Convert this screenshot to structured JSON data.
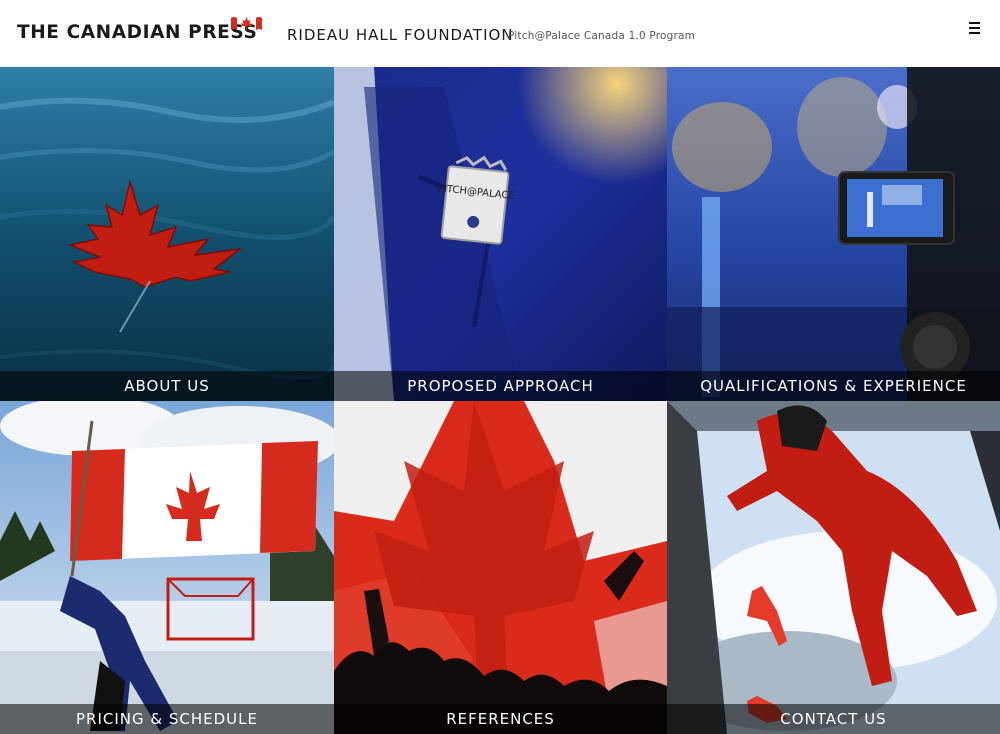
{
  "header": {
    "brand": "THE CANADIAN PRESS",
    "client": "RIDEAU HALL FOUNDATION",
    "program": "Pitch@Palace Canada 1.0 Program",
    "menu_icon": "hamburger-menu-icon"
  },
  "tiles": [
    {
      "label": "ABOUT US",
      "image": "maple-leaf-on-water"
    },
    {
      "label": "PROPOSED APPROACH",
      "image": "pitch-at-palace-lapel-pin",
      "pin_text": "PITCH@PALACE"
    },
    {
      "label": "QUALIFICATIONS & EXPERIENCE",
      "image": "video-camera-at-event"
    },
    {
      "label": "PRICING & SCHEDULE",
      "image": "hockey-player-with-canadian-flag"
    },
    {
      "label": "REFERENCES",
      "image": "crowd-under-giant-canadian-flag"
    },
    {
      "label": "CONTACT US",
      "image": "skydivers-in-red-suits"
    }
  ],
  "colors": {
    "canada_red": "#d52b1e",
    "label_overlay": "rgba(0,0,0,0.55)",
    "text_dark": "#1a1a1a"
  }
}
